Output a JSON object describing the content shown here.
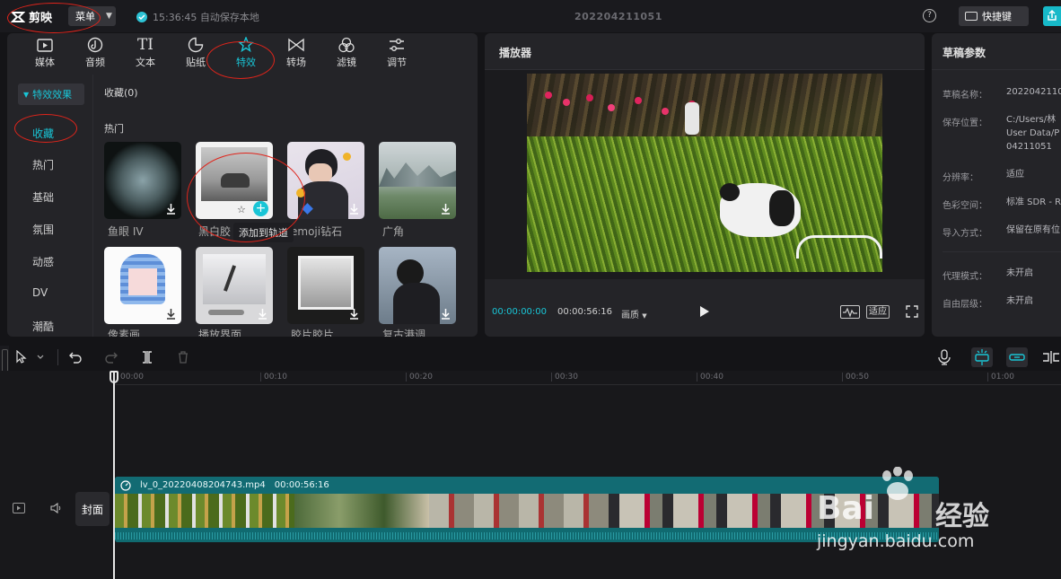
{
  "titlebar": {
    "app_name": "剪映",
    "menu_label": "菜单",
    "autosave_text": "15:36:45 自动保存本地",
    "project_title": "202204211051",
    "shortcut_label": "快捷键"
  },
  "tabs": [
    {
      "label": "媒体",
      "icon": "media-icon"
    },
    {
      "label": "音频",
      "icon": "audio-icon"
    },
    {
      "label": "文本",
      "icon": "text-icon"
    },
    {
      "label": "贴纸",
      "icon": "sticker-icon"
    },
    {
      "label": "特效",
      "icon": "effects-icon",
      "active": true
    },
    {
      "label": "转场",
      "icon": "transition-icon"
    },
    {
      "label": "滤镜",
      "icon": "filter-icon"
    },
    {
      "label": "调节",
      "icon": "adjust-icon"
    }
  ],
  "effects_sidebar": {
    "header": "特效效果",
    "items": [
      "收藏",
      "热门",
      "基础",
      "氛围",
      "动感",
      "DV",
      "潮酷"
    ]
  },
  "library": {
    "favorites_label": "收藏(0)",
    "hot_label": "热门",
    "row1": [
      "鱼眼 IV",
      "黑白胶",
      "emoji钻石",
      "广角"
    ],
    "row2": [
      "像素画",
      "播放界面",
      "胶片胶片",
      "复古港调"
    ],
    "tooltip": "添加到轨道"
  },
  "player": {
    "title": "播放器",
    "current_time": "00:00:00:00",
    "total_time": "00:00:56:16",
    "quality_label": "画质",
    "fit_label": "适应"
  },
  "params": {
    "title": "草稿参数",
    "rows": [
      {
        "key": "草稿名称：",
        "value": "2022042110"
      },
      {
        "key": "保存位置：",
        "value": "C:/Users/林 User Data/P 04211051"
      },
      {
        "key": "分辨率：",
        "value": "适应"
      },
      {
        "key": "色彩空间：",
        "value": "标准 SDR - R"
      },
      {
        "key": "导入方式：",
        "value": "保留在原有位"
      },
      {
        "key": "代理模式：",
        "value": "未开启"
      },
      {
        "key": "自由层级：",
        "value": "未开启"
      }
    ]
  },
  "timeline": {
    "ticks": [
      "00:00",
      "00:10",
      "00:20",
      "00:30",
      "00:40",
      "00:50",
      "01:00"
    ],
    "cover_label": "封面",
    "clip_name": "lv_0_20220408204743.mp4",
    "clip_duration": "00:00:56:16"
  },
  "watermark": {
    "brand": "Bai",
    "cn": "经验",
    "url": "jingyan.baidu.com"
  }
}
